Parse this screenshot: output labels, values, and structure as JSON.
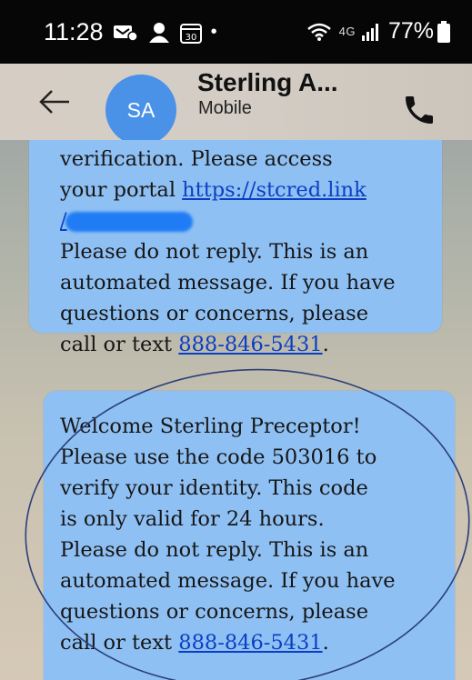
{
  "status_bar": {
    "time": "11:28",
    "dot": "•",
    "calendar_day": "30",
    "network": "4G",
    "battery": "77%"
  },
  "header": {
    "avatar_initials": "SA",
    "contact_name": "Sterling A...",
    "contact_subtitle": "Mobile"
  },
  "messages": [
    {
      "lines": [
        "verification.  Please access",
        "your portal ",
        "https://stcred.link",
        "/",
        "Please do not reply. This is an",
        "automated message. If you have",
        "questions or concerns, please",
        "call or text ",
        "888-846-5431",
        "."
      ]
    },
    {
      "lines": [
        "Welcome Sterling Preceptor!",
        "Please use the code 503016 to",
        "verify your identity.  This code",
        "is only valid for 24 hours.",
        "Please do not reply. This is an",
        "automated message. If you have",
        "questions or concerns, please",
        "call or text ",
        "888-846-5431",
        "."
      ]
    }
  ],
  "colors": {
    "bubble": "#8fc0f3",
    "link": "#0a3fc4",
    "avatar": "#4a92e8",
    "annotation": "#2b3f7a"
  }
}
